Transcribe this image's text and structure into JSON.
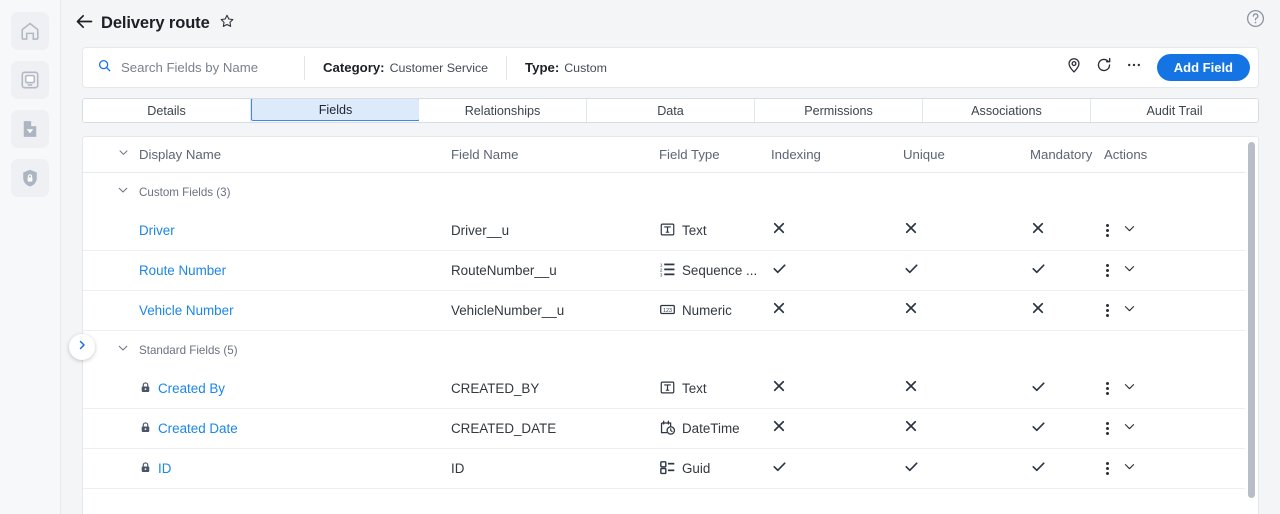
{
  "sidebar": {
    "items": [
      {
        "name": "home-icon",
        "label": "Home"
      },
      {
        "name": "app-icon",
        "label": "Apps"
      },
      {
        "name": "document-check-icon",
        "label": "Documents"
      },
      {
        "name": "shield-lock-icon",
        "label": "Security"
      }
    ],
    "expand_label": "Expand navigation"
  },
  "header": {
    "back_label": "Back",
    "title": "Delivery route",
    "star_label": "Favorite",
    "help_label": "Help"
  },
  "toolbar": {
    "search_placeholder": "Search Fields by Name",
    "search_value": "",
    "category_label": "Category:",
    "category_value": "Customer Service",
    "type_label": "Type:",
    "type_value": "Custom",
    "location_icon": "location-pin-icon",
    "refresh_icon": "refresh-icon",
    "more_icon": "more-options-icon",
    "add_field_label": "Add Field"
  },
  "tabs": {
    "items": [
      {
        "label": "Details",
        "active": false
      },
      {
        "label": "Fields",
        "active": true
      },
      {
        "label": "Relationships",
        "active": false
      },
      {
        "label": "Data",
        "active": false
      },
      {
        "label": "Permissions",
        "active": false
      },
      {
        "label": "Associations",
        "active": false
      },
      {
        "label": "Audit Trail",
        "active": false
      }
    ]
  },
  "table": {
    "columns": [
      "Display Name",
      "Field Name",
      "Field Type",
      "Indexing",
      "Unique",
      "Mandatory",
      "Actions"
    ],
    "groups": [
      {
        "label": "Custom Fields (3)",
        "expanded": true,
        "rows": [
          {
            "display_name": "Driver",
            "locked": false,
            "field_name": "Driver__u",
            "field_type": "Text",
            "type_icon": "text-type-icon",
            "indexing": false,
            "unique": false,
            "mandatory": false
          },
          {
            "display_name": "Route Number",
            "locked": false,
            "field_name": "RouteNumber__u",
            "field_type": "Sequence ...",
            "type_icon": "sequence-type-icon",
            "indexing": true,
            "unique": true,
            "mandatory": true
          },
          {
            "display_name": "Vehicle Number",
            "locked": false,
            "field_name": "VehicleNumber__u",
            "field_type": "Numeric",
            "type_icon": "numeric-type-icon",
            "indexing": false,
            "unique": false,
            "mandatory": false
          }
        ]
      },
      {
        "label": "Standard Fields (5)",
        "expanded": true,
        "rows": [
          {
            "display_name": "Created By",
            "locked": true,
            "field_name": "CREATED_BY",
            "field_type": "Text",
            "type_icon": "text-type-icon",
            "indexing": false,
            "unique": false,
            "mandatory": true
          },
          {
            "display_name": "Created Date",
            "locked": true,
            "field_name": "CREATED_DATE",
            "field_type": "DateTime",
            "type_icon": "datetime-type-icon",
            "indexing": false,
            "unique": false,
            "mandatory": true
          },
          {
            "display_name": "ID",
            "locked": true,
            "field_name": "ID",
            "field_type": "Guid",
            "type_icon": "guid-type-icon",
            "indexing": true,
            "unique": true,
            "mandatory": true
          }
        ]
      }
    ]
  },
  "colors": {
    "accent": "#1474e4",
    "link": "#1b86e8",
    "tab_active_bg": "#dceafa",
    "tab_active_border": "#3f8ae0",
    "page_bg": "#f4f5f7"
  }
}
